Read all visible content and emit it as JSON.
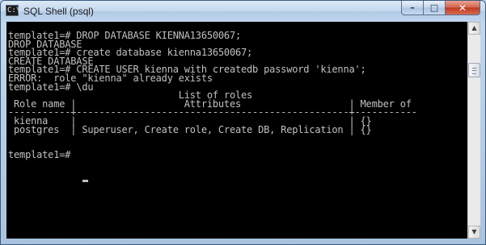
{
  "window": {
    "title": "SQL Shell (psql)",
    "icon_glyph": "C:\\",
    "buttons": {
      "minimize_glyph": "–",
      "maximize_glyph": "□",
      "close_glyph": "✕"
    }
  },
  "console": {
    "lines": [
      "template1=# DROP DATABASE KIENNA13650067;",
      "DROP DATABASE",
      "template1=# create database kienna13650067;",
      "CREATE DATABASE",
      "template1=# CREATE USER kienna with createdb password 'kienna';",
      "ERROR:  role \"kienna\" already exists",
      "template1=# \\du",
      "                              List of roles",
      " Role name |                   Attributes                   | Member of",
      "-----------+------------------------------------------------+-----------",
      " kienna    |                                                | {}",
      " postgres  | Superuser, Create role, Create DB, Replication | {}",
      "",
      "",
      "template1=# "
    ],
    "text_color": "#c0c0c0",
    "background": "#000000"
  },
  "scrollbar": {
    "up_glyph": "▲",
    "down_glyph": "▼"
  }
}
